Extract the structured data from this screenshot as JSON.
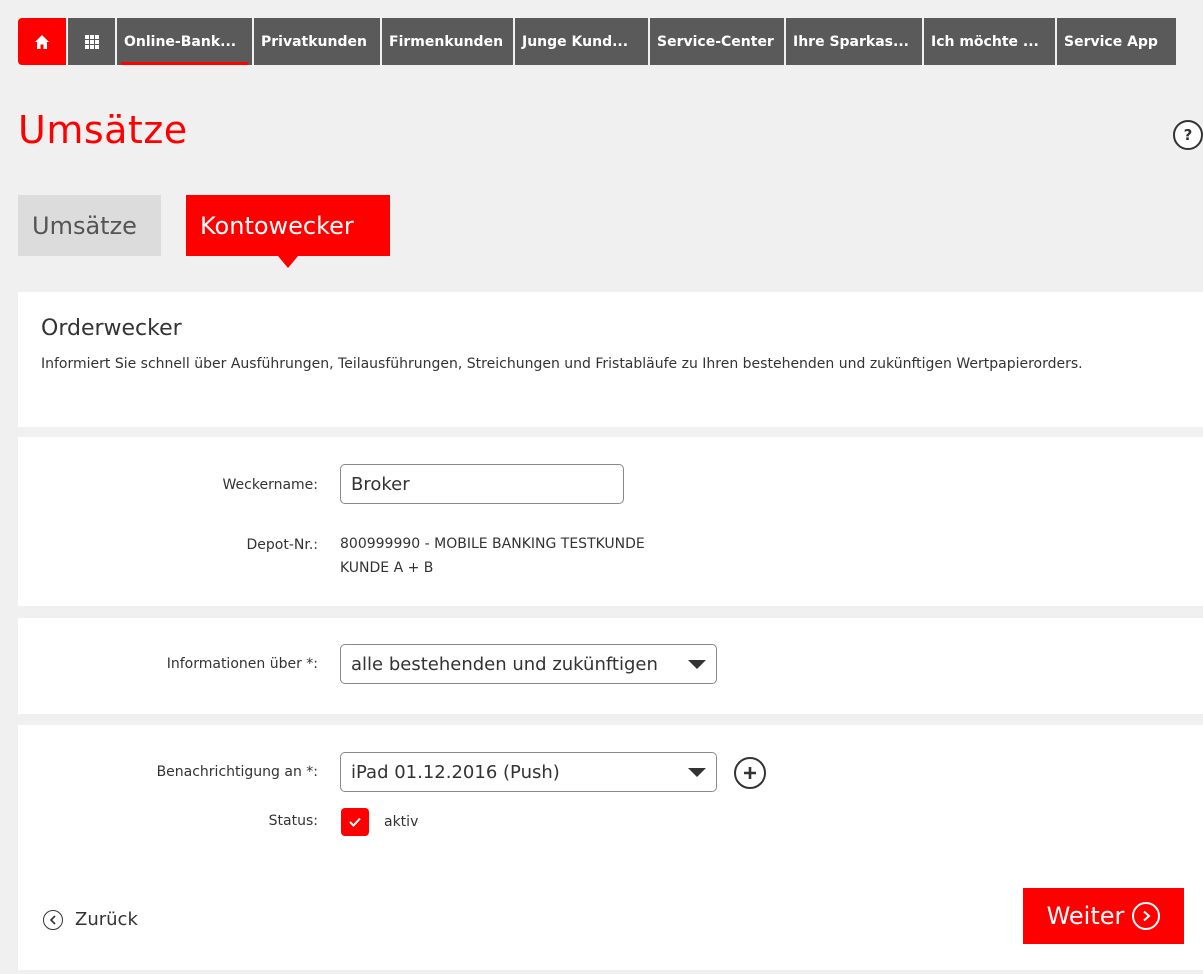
{
  "nav": {
    "home_icon": "home-icon",
    "grid_icon": "apps-grid-icon",
    "items": [
      {
        "label": "Online-Bank..."
      },
      {
        "label": "Privatkunden"
      },
      {
        "label": "Firmenkunden"
      },
      {
        "label": "Junge Kund..."
      },
      {
        "label": "Service-Center"
      },
      {
        "label": "Ihre Sparkas..."
      },
      {
        "label": "Ich möchte ..."
      },
      {
        "label": "Service App"
      }
    ]
  },
  "page": {
    "title": "Umsätze",
    "help_label": "?"
  },
  "tabs": [
    {
      "label": "Umsätze"
    },
    {
      "label": "Kontowecker"
    }
  ],
  "orderwecker": {
    "title": "Orderwecker",
    "description": "Informiert Sie schnell über Ausführungen, Teilausführungen, Streichungen und Fristabläufe zu Ihren bestehenden und zukünftigen Wertpapierorders."
  },
  "form": {
    "weckername_label": "Weckername:",
    "weckername_value": "Broker",
    "depot_label": "Depot-Nr.:",
    "depot_value_line1": "800999990 - MOBILE BANKING TESTKUNDE",
    "depot_value_line2": "KUNDE A + B",
    "info_label": "Informationen über *:",
    "info_value": "alle bestehenden und zukünftigen",
    "notify_label": "Benachrichtigung an *:",
    "notify_value": "iPad 01.12.2016 (Push)",
    "status_label": "Status:",
    "status_value": "aktiv",
    "status_checked": true
  },
  "actions": {
    "back_label": "Zurück",
    "next_label": "Weiter"
  },
  "colors": {
    "brand_red": "#ff0000",
    "nav_gray": "#5a5a5a",
    "background": "#f0f0f0"
  }
}
